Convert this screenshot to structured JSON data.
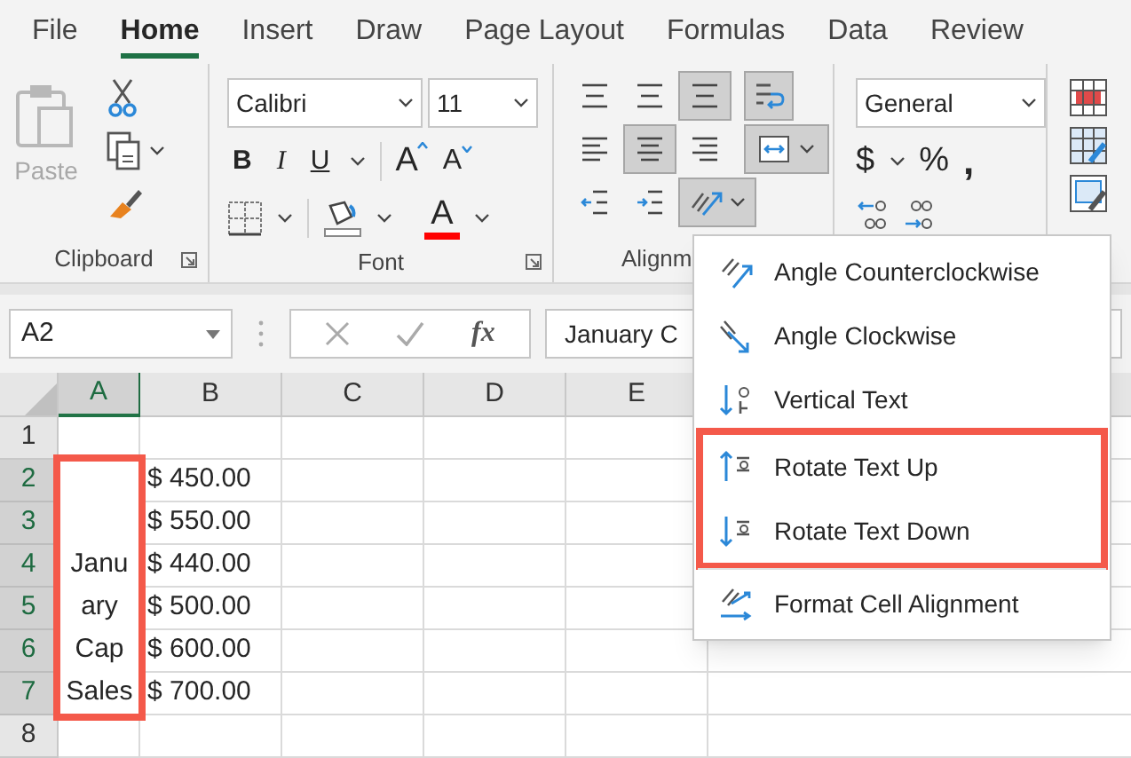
{
  "tabs": [
    {
      "label": "File",
      "selected": false
    },
    {
      "label": "Home",
      "selected": true
    },
    {
      "label": "Insert",
      "selected": false
    },
    {
      "label": "Draw",
      "selected": false
    },
    {
      "label": "Page Layout",
      "selected": false
    },
    {
      "label": "Formulas",
      "selected": false
    },
    {
      "label": "Data",
      "selected": false
    },
    {
      "label": "Review",
      "selected": false
    }
  ],
  "ribbon": {
    "clipboard": {
      "paste_label": "Paste",
      "paste_disabled": true,
      "group_label": "Clipboard"
    },
    "font": {
      "font_name": "Calibri",
      "font_size": "11",
      "bold": "B",
      "italic": "I",
      "underline": "U",
      "grow": "A",
      "shrink": "A",
      "font_color": "A",
      "group_label": "Font"
    },
    "alignment": {
      "buttons": [
        {
          "kind": "top",
          "selected": false
        },
        {
          "kind": "middle",
          "selected": false
        },
        {
          "kind": "bottom",
          "selected": true
        },
        {
          "kind": "left",
          "selected": false
        },
        {
          "kind": "center",
          "selected": true
        },
        {
          "kind": "right",
          "selected": false
        },
        {
          "kind": "outdent",
          "selected": false
        },
        {
          "kind": "indent",
          "selected": false
        }
      ],
      "wrap_selected": true,
      "merge_selected": true,
      "orientation_selected": true,
      "group_label": "Alignm"
    },
    "number": {
      "format": "General",
      "currency": "$",
      "percent": "%",
      "comma": ","
    }
  },
  "formula_bar": {
    "name_box": "A2",
    "fx": "fx",
    "content": "January C"
  },
  "sheet": {
    "columns": [
      {
        "label": "A",
        "selected": true
      },
      {
        "label": "B",
        "selected": false
      },
      {
        "label": "C",
        "selected": false
      },
      {
        "label": "D",
        "selected": false
      },
      {
        "label": "E",
        "selected": false
      }
    ],
    "rows": [
      {
        "number": "1",
        "selected": false
      },
      {
        "number": "2",
        "selected": true,
        "b": "$ 450.00"
      },
      {
        "number": "3",
        "selected": true,
        "b": "$ 550.00"
      },
      {
        "number": "4",
        "selected": true,
        "b": "$ 440.00"
      },
      {
        "number": "5",
        "selected": true,
        "b": "$ 500.00"
      },
      {
        "number": "6",
        "selected": true,
        "b": "$ 600.00"
      },
      {
        "number": "7",
        "selected": true,
        "b": "$ 700.00"
      },
      {
        "number": "8",
        "selected": false
      }
    ],
    "merged_cell": {
      "lines": [
        "Janu",
        "ary",
        "Cap",
        "Sales"
      ],
      "boxed": true
    }
  },
  "menu": {
    "groups": [
      {
        "highlighted": false,
        "items": [
          {
            "kind": "angle-ccw",
            "label": "Angle Counterclockwise"
          },
          {
            "kind": "angle-cw",
            "label": "Angle Clockwise"
          },
          {
            "kind": "vertical",
            "label": "Vertical Text"
          }
        ]
      },
      {
        "highlighted": true,
        "items": [
          {
            "kind": "rotate-up",
            "label": "Rotate Text Up"
          },
          {
            "kind": "rotate-down",
            "label": "Rotate Text Down"
          }
        ]
      },
      {
        "highlighted": false,
        "items": [
          {
            "kind": "format",
            "label": "Format Cell Alignment"
          }
        ]
      }
    ]
  }
}
